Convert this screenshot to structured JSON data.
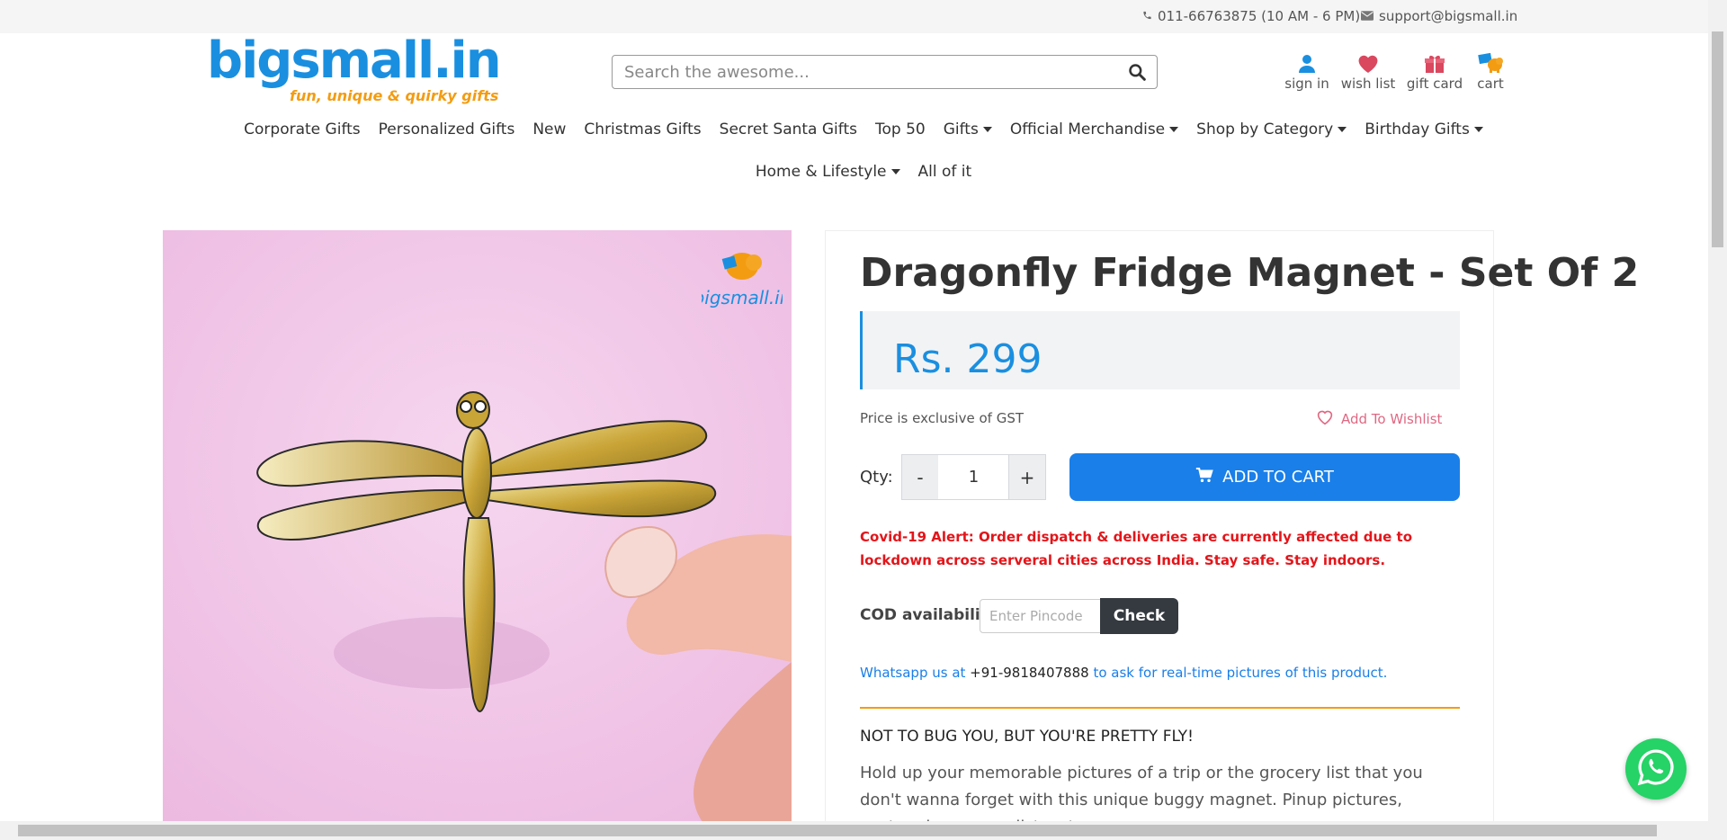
{
  "topbar": {
    "phone": "011-66763875 (10 AM - 6 PM)",
    "email": "support@bigsmall.in"
  },
  "logo": {
    "wordmark": "bigsmall.in",
    "tagline": "fun, unique & quirky gifts"
  },
  "search": {
    "placeholder": "Search the awesome..."
  },
  "header_links": {
    "sign_in": "sign in",
    "wish_list": "wish list",
    "gift_card": "gift card",
    "cart": "cart"
  },
  "nav": {
    "row1": [
      {
        "label": "Corporate Gifts",
        "dropdown": false
      },
      {
        "label": "Personalized Gifts",
        "dropdown": false
      },
      {
        "label": "New",
        "dropdown": false
      },
      {
        "label": "Christmas Gifts",
        "dropdown": false
      },
      {
        "label": "Secret Santa Gifts",
        "dropdown": false
      },
      {
        "label": "Top 50",
        "dropdown": false
      },
      {
        "label": "Gifts",
        "dropdown": true
      },
      {
        "label": "Official Merchandise",
        "dropdown": true
      },
      {
        "label": "Shop by Category",
        "dropdown": true
      },
      {
        "label": "Birthday Gifts",
        "dropdown": true
      }
    ],
    "row2": [
      {
        "label": "Home & Lifestyle",
        "dropdown": true
      },
      {
        "label": "All of it",
        "dropdown": false
      }
    ]
  },
  "product": {
    "watermark": "bigsmall.in",
    "title": "Dragonfly Fridge Magnet - Set Of 2",
    "price": "Rs. 299",
    "gst_note": "Price is exclusive of GST",
    "wishlist_label": "Add To Wishlist",
    "qty_label": "Qty:",
    "qty_value": "1",
    "minus_label": "-",
    "plus_label": "+",
    "add_to_cart_label": "ADD TO CART",
    "alert": "Covid-19 Alert: Order dispatch & deliveries are currently affected due to lockdown across serveral cities across India. Stay safe. Stay indoors.",
    "cod_label": "COD availability",
    "pincode_placeholder": "Enter Pincode",
    "check_label": "Check",
    "whatsapp_prefix": "Whatsapp us at ",
    "whatsapp_number": "+91-9818407888",
    "whatsapp_suffix": " to ask for real-time pictures of this product.",
    "desc_heading": "NOT TO BUG YOU, BUT YOU'RE PRETTY FLY!",
    "desc_body": "Hold up your memorable pictures of a trip or the grocery list that you don't wanna forget with this unique buggy magnet. Pinup pictures, postcards, grocery lists, etc."
  },
  "colors": {
    "brand_blue": "#1a8fe0",
    "button_blue": "#1a7fe8",
    "alert_red": "#e3151a",
    "accent_orange": "#f39c12",
    "whatsapp_green": "#25d366"
  }
}
